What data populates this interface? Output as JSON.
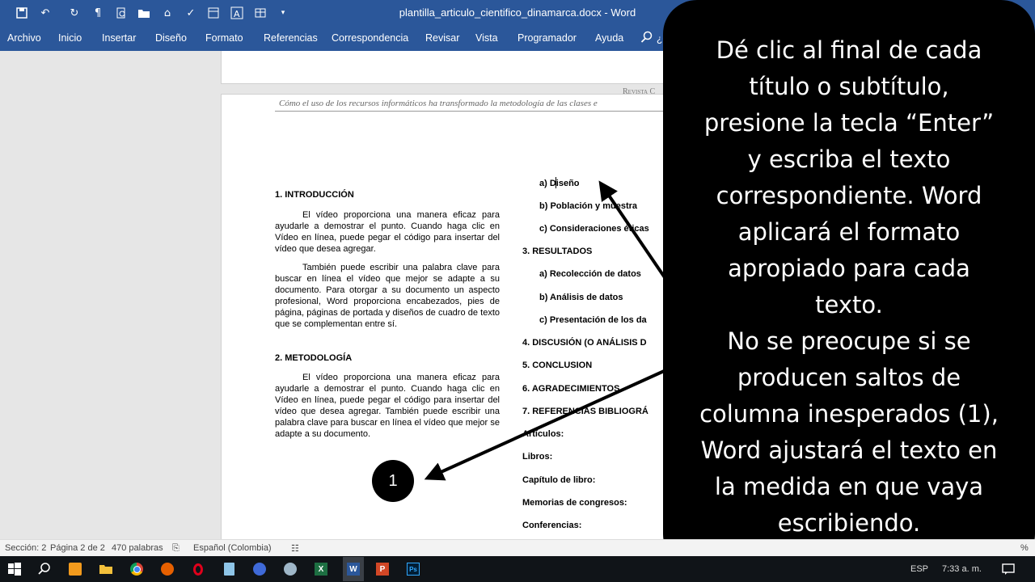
{
  "titlebar": {
    "document_title": "plantilla_articulo_cientifico_dinamarca.docx  -  Word",
    "quick_access_icons": [
      "save-icon",
      "undo-icon",
      "redo-icon",
      "paragraph-mark-icon",
      "print-preview-icon",
      "open-folder-icon",
      "home-icon",
      "spellcheck-icon",
      "layout-icon",
      "text-box-icon",
      "table-icon",
      "customize-icon"
    ],
    "close_glyph": "✕"
  },
  "ribbon": {
    "tabs": [
      "Archivo",
      "Inicio",
      "Insertar",
      "Diseño",
      "Formato",
      "Referencias",
      "Correspondencia",
      "Revisar",
      "Vista",
      "Programador",
      "Ayuda"
    ],
    "search_hint": "¿Q"
  },
  "document": {
    "header_journal": "Revista C",
    "header_subtitle": "Cómo el uso de los recursos informáticos ha transformado la metodología de las clases e",
    "left_column": {
      "h1": "1.    INTRODUCCIÓN",
      "p1": "El vídeo proporciona una manera eficaz para ayudarle a demostrar el punto. Cuando haga clic en Vídeo en línea, puede pegar el código para insertar del vídeo que desea agregar.",
      "p2": "También puede escribir una palabra clave para buscar en línea el vídeo que mejor se adapte a su documento. Para otorgar a su documento un aspecto profesional, Word proporciona encabezados, pies de página, páginas de portada y diseños de cuadro de texto que se complementan entre sí.",
      "h2": "2.    METODOLOGÍA",
      "p3": "El vídeo proporciona una manera eficaz para ayudarle a demostrar el punto. Cuando haga clic en Vídeo en línea, puede pegar el código para insertar del vídeo que desea agregar. También puede escribir una palabra clave para buscar en línea el vídeo que mejor se adapte a su documento."
    },
    "right_column": {
      "a_diseno": "a)   Diseño",
      "b_poblacion": "b)   Población y muestra",
      "c_consideraciones": "c)   Consideraciones éticas",
      "h3": "3.    RESULTADOS",
      "a_recoleccion": "a)   Recolección de datos",
      "b_analisis": "b)   Análisis de datos",
      "c_presentacion": "c)   Presentación de los da",
      "h4": "4.    DISCUSIÓN (O ANÁLISIS D",
      "h5": "5.    CONCLUSION",
      "h6": "6.    AGRADECIMIENTOS",
      "h7": "7.    REFERENCIAS BIBLIOGRÁ",
      "articulos": "Artículos:",
      "libros": "Libros:",
      "capitulo": "Capítulo de libro:",
      "memorias": "Memorias de congresos:",
      "conferencias": "Conferencias:"
    }
  },
  "callout": {
    "text": "Dé clic al final de cada\ntítulo o subtítulo,\npresione la tecla “Enter”\ny escriba  el texto\ncorrespondiente. Word\naplicará el formato\napropiado para cada\ntexto.\nNo se preocupe si se\nproducen saltos de\ncolumna inesperados (1),\nWord ajustará el texto en\nla medida en que vaya\nescribiendo.",
    "badge": "1"
  },
  "statusbar": {
    "section": "Sección: 2",
    "page": "Página 2 de 2",
    "words": "470 palabras",
    "language": "Español (Colombia)",
    "zoom_partial": "%"
  },
  "taskbar": {
    "icons": [
      "windows-start-icon",
      "search-icon",
      "sublime-icon",
      "file-explorer-icon",
      "chrome-icon",
      "firefox-icon",
      "opera-icon",
      "notepad-icon",
      "pen-icon",
      "network-icon",
      "excel-icon",
      "word-icon",
      "powerpoint-icon",
      "photoshop-icon"
    ],
    "language": "ESP",
    "time": "7:33 a. m."
  },
  "colors": {
    "word_blue": "#2b579a",
    "callout_black": "#000000",
    "taskbar": "#101418"
  }
}
